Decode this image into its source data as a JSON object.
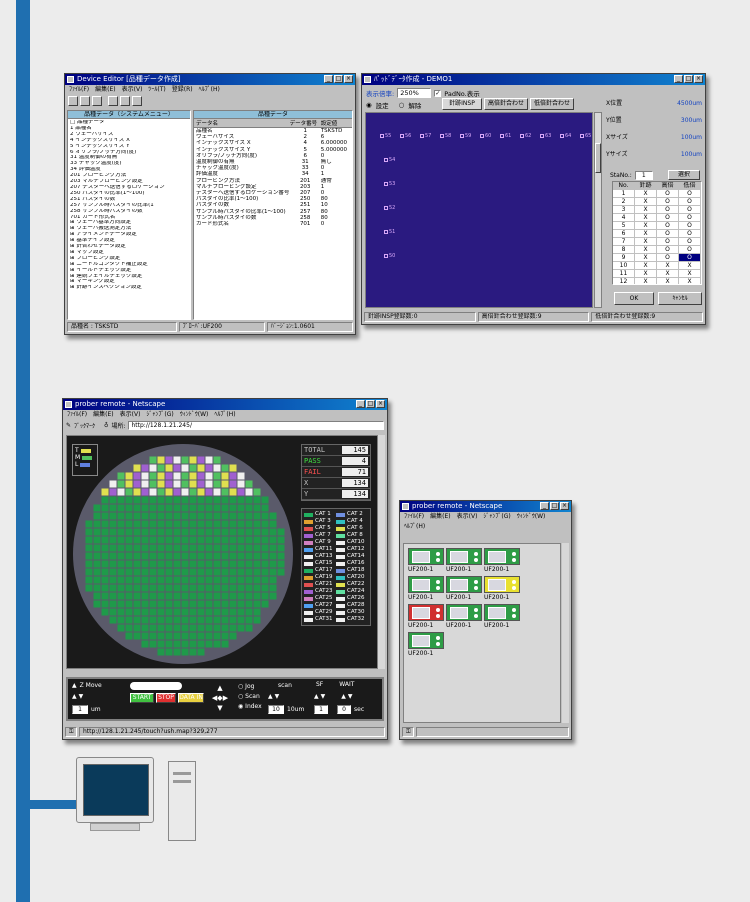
{
  "device_editor": {
    "title": "Device Editor [品種データ作成]",
    "menu": [
      "ﾌｧｲﾙ(F)",
      "編集(E)",
      "表示(V)",
      "ﾂｰﾙ(T)",
      "登録(R)",
      "ﾍﾙﾌﾟ(H)"
    ],
    "left_header": "品種データ（システムメニュー）",
    "right_header": "品種データ",
    "tree": [
      "□ 品種データ",
      "  1 品種名",
      "  2 ウェーハサイズ",
      "  4 インデックスサイズ X",
      "  5 インデックスサイズ Y",
      "  6 オリフラ/ノッチ方向(度)",
      "  31 温度制御の有無",
      "  33 チャック温度(度)",
      "  34 評価温度",
      "  201 プロービング方法",
      "  203 マルチプロービング設定",
      "  207 テスターへ送信するロケーション",
      "  250 パスダイの比率(1〜100)",
      "  251 パスダイの数",
      "  257 サンプル時パスダイの比率(1",
      "  258 サンプル時パスダイの数",
      "  701 カード形式名",
      "⊞ ウェーハ基準方向設定",
      "⊞ ウェーハ搬送測定方法",
      "⊞ アライメントデータ設定",
      "⊞ 基準チイプ設定",
      "⊞ 針合わせデータ設定",
      "⊞ マップ設定",
      "⊞ プロービング設定",
      "⊞ ニードルコンタクト補正設定",
      "⊞ イールドチェック設定",
      "⊞ 連続フェイルチェック設定",
      "⊞ マーキング設定",
      "⊞ 針跡インスペクション設定"
    ],
    "col_heads": [
      "データ名",
      "データ番号",
      "設定値"
    ],
    "rows": [
      [
        "品種名",
        "1",
        "TSKSTD"
      ],
      [
        "ウェーハサイズ",
        "2",
        "6"
      ],
      [
        "インデックスサイズ X",
        "4",
        "6.000000"
      ],
      [
        "インデックスサイズ Y",
        "5",
        "5.000000"
      ],
      [
        "オリフラ/ノッチ方向(度)",
        "6",
        "0"
      ],
      [
        "温度制御の有無",
        "31",
        "無し"
      ],
      [
        "チャック温度(度)",
        "33",
        "0"
      ],
      [
        "評価温度",
        "34",
        "1"
      ],
      [
        "プロービング方法",
        "201",
        "通常"
      ],
      [
        "マルチプロービング設定",
        "203",
        "1"
      ],
      [
        "テスターへ送信するロケーション番号",
        "207",
        "0"
      ],
      [
        "パスダイの比率(1〜100)",
        "250",
        "80"
      ],
      [
        "パスダイの数",
        "251",
        "10"
      ],
      [
        "サンプル時パスダイの比率(1〜100)",
        "257",
        "80"
      ],
      [
        "サンプル時パスダイの数",
        "258",
        "80"
      ],
      [
        "カード形式名",
        "701",
        "0"
      ]
    ],
    "status": [
      "品種名 : TSKSTD",
      "ﾌﾟﾛｰﾊﾞ:UF200",
      "ﾊﾞｰｼﾞｮﾝ:1.0601"
    ]
  },
  "pad_editor": {
    "title": "ﾊﾟｯﾄﾞﾃﾞｰﾀ作成 - DEMO1",
    "zoom_label": "表示倍率:",
    "zoom_value": "250%",
    "padno_label": "PadNo.表示",
    "radio_set": "設定",
    "radio_release": "解除",
    "tabs": [
      "針跡INSP",
      "高倍針合わせ",
      "低倍針合わせ"
    ],
    "pads_top": [
      "55",
      "56",
      "57",
      "58",
      "59",
      "60",
      "61",
      "62",
      "63",
      "64",
      "65"
    ],
    "pads_side": [
      "54",
      "53",
      "52",
      "51",
      "50"
    ],
    "fields": [
      [
        "X位置",
        "4500um"
      ],
      [
        "Y位置",
        "300um"
      ],
      [
        "Xサイズ",
        "100um"
      ],
      [
        "Yサイズ",
        "100um"
      ]
    ],
    "stano_label": "StaNo.:",
    "stano_value": "1",
    "select_button": "選択",
    "table_heads": [
      "No.",
      "針跡",
      "高倍",
      "低倍"
    ],
    "table_rows": [
      [
        "1",
        "X",
        "O",
        "O"
      ],
      [
        "2",
        "X",
        "O",
        "O"
      ],
      [
        "3",
        "X",
        "O",
        "O"
      ],
      [
        "4",
        "X",
        "O",
        "O"
      ],
      [
        "5",
        "X",
        "O",
        "O"
      ],
      [
        "6",
        "X",
        "O",
        "O"
      ],
      [
        "7",
        "X",
        "O",
        "O"
      ],
      [
        "8",
        "X",
        "O",
        "O"
      ],
      [
        "9",
        "X",
        "O",
        "O"
      ],
      [
        "10",
        "X",
        "X",
        "X"
      ],
      [
        "11",
        "X",
        "X",
        "X"
      ],
      [
        "12",
        "X",
        "X",
        "X"
      ]
    ],
    "ok": "OK",
    "cancel": "ｷｬﾝｾﾙ",
    "status": [
      "針跡INSP登録数:0",
      "高倍針合わせ登録数:9",
      "低倍針合わせ登録数:9"
    ]
  },
  "prober_remote": {
    "title": "prober remote - Netscape",
    "menu": [
      "ﾌｧｲﾙ(F)",
      "編集(E)",
      "表示(V)",
      "ｼﾞｬﾝﾌﾟ(G)",
      "ｳｨﾝﾄﾞｳ(W)",
      "ﾍﾙﾌﾟ(H)"
    ],
    "bookmark": "ﾌﾞｯｸﾏｰｸ",
    "location_label": "場所:",
    "url": "http://128.1.21.245/",
    "legend": [
      "T",
      "M",
      "L"
    ],
    "stats": [
      [
        "TOTAL",
        "145"
      ],
      [
        "PASS",
        "4"
      ],
      [
        "FAIL",
        "71"
      ],
      [
        "X",
        "134"
      ],
      [
        "Y",
        "134"
      ]
    ],
    "cats": [
      [
        "CAT 1",
        "CAT 2"
      ],
      [
        "CAT 3",
        "CAT 4"
      ],
      [
        "CAT 5",
        "CAT 6"
      ],
      [
        "CAT 7",
        "CAT 8"
      ],
      [
        "CAT 9",
        "CAT10"
      ],
      [
        "CAT11",
        "CAT12"
      ],
      [
        "CAT13",
        "CAT14"
      ],
      [
        "CAT15",
        "CAT16"
      ],
      [
        "CAT17",
        "CAT18"
      ],
      [
        "CAT19",
        "CAT20"
      ],
      [
        "CAT21",
        "CAT22"
      ],
      [
        "CAT23",
        "CAT24"
      ],
      [
        "CAT25",
        "CAT26"
      ],
      [
        "CAT27",
        "CAT28"
      ],
      [
        "CAT29",
        "CAT30"
      ],
      [
        "CAT31",
        "CAT32"
      ]
    ],
    "cat_colors": [
      "#20b060",
      "#7090e0",
      "#e0a030",
      "#30c0c0",
      "#e05050",
      "#e0e050",
      "#a060d0",
      "#60e0a0",
      "#d080c0",
      "#f0f0f0",
      "#50a0f0",
      "#f0f0f0",
      "#f0f0f0",
      "#f0f0f0",
      "#f0f0f0",
      "#f0f0f0"
    ],
    "ctrl": {
      "z_move": "Z Move",
      "start": "START",
      "stop": "STOP",
      "data_in": "DATA IN",
      "jog": "Jog",
      "scan": "Scan",
      "index": "Index",
      "scan_label": "scan",
      "sf": "SF",
      "wait": "WAIT",
      "num1": "1",
      "unit1": "um",
      "num2": "10",
      "unit2": "10um",
      "num3": "1",
      "num4": "0",
      "unit3": "sec"
    },
    "status_url": "http://128.1.21.245/touch?ush.map?329,277"
  },
  "prober_list": {
    "title": "prober remote - Netscape",
    "menu": [
      "ﾌｧｲﾙ(F)",
      "編集(E)",
      "表示(V)",
      "ｼﾞｬﾝﾌﾟ(G)",
      "ｳｨﾝﾄﾞｳ(W)",
      "ﾍﾙﾌﾟ(H)"
    ],
    "devices": [
      {
        "label": "UF200-1",
        "color": "#2e9c46"
      },
      {
        "label": "UF200-1",
        "color": "#2e9c46"
      },
      {
        "label": "UF200-1",
        "color": "#2e9c46"
      },
      {
        "label": "UF200-1",
        "color": "#2e9c46"
      },
      {
        "label": "UF200-1",
        "color": "#2e9c46"
      },
      {
        "label": "UF200-1",
        "color": "#e8e030"
      },
      {
        "label": "UF200-1",
        "color": "#d03030"
      },
      {
        "label": "UF200-1",
        "color": "#2e9c46"
      },
      {
        "label": "UF200-1",
        "color": "#2e9c46"
      },
      {
        "label": "UF200-1",
        "color": "#2e9c46"
      }
    ]
  }
}
